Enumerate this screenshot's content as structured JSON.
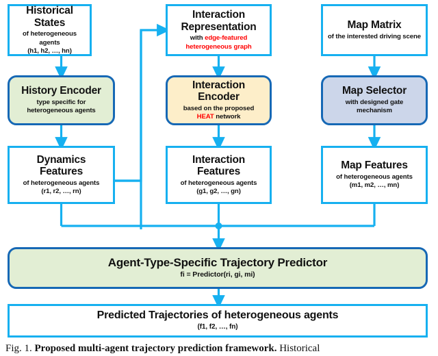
{
  "figure": {
    "nodes": {
      "historical_states": {
        "title": "Historical States",
        "sub_line1": "of heterogeneous agents",
        "sub_line2": "(h1, h2, …, hn)"
      },
      "interaction_representation": {
        "title_line1": "Interaction",
        "title_line2": "Representation",
        "sub_prefix": "with ",
        "sub_red1": "edge-featured",
        "sub_red2": "heterogeneous graph"
      },
      "map_matrix": {
        "title": "Map Matrix",
        "sub_line1": "of the interested driving scene"
      },
      "history_encoder": {
        "title": "History Encoder",
        "sub_line1": "type specific for",
        "sub_line2": "heterogeneous agents"
      },
      "interaction_encoder": {
        "title_line1": "Interaction",
        "title_line2": "Encoder",
        "sub_line1": "based on the proposed",
        "sub_red": "HEAT",
        "sub_suffix": " network"
      },
      "map_selector": {
        "title": "Map Selector",
        "sub_line1": "with designed gate",
        "sub_line2": "mechanism"
      },
      "dynamics_features": {
        "title_line1": "Dynamics",
        "title_line2": "Features",
        "sub_line1": "of heterogeneous agents",
        "sub_line2": "(r1, r2, …, rn)"
      },
      "interaction_features": {
        "title_line1": "Interaction",
        "title_line2": "Features",
        "sub_line1": "of heterogeneous agents",
        "sub_line2": "(g1, g2, …, gn)"
      },
      "map_features": {
        "title": "Map Features",
        "sub_line1": "of heterogeneous agents",
        "sub_line2": "(m1, m2, …, mn)"
      },
      "trajectory_predictor": {
        "title": "Agent-Type-Specific Trajectory Predictor",
        "sub_line1": "fi = Predictor(ri, gi, mi)"
      },
      "predicted_trajectories": {
        "title": "Predicted Trajectories of heterogeneous agents",
        "sub_line1": "(f1, f2, …, fn)"
      }
    },
    "colors": {
      "arrow_blue": "#16b0f0",
      "rounded_border_blue": "#1668b5",
      "encoder_green": "#e2eed4",
      "encoder_cream": "#fdeec9",
      "selector_blue": "#ccd6ea",
      "highlight_red": "#ff0000"
    },
    "caption": {
      "label": "Fig. 1.",
      "bold_text": "Proposed multi-agent trajectory prediction framework.",
      "rest": " Historical"
    }
  }
}
